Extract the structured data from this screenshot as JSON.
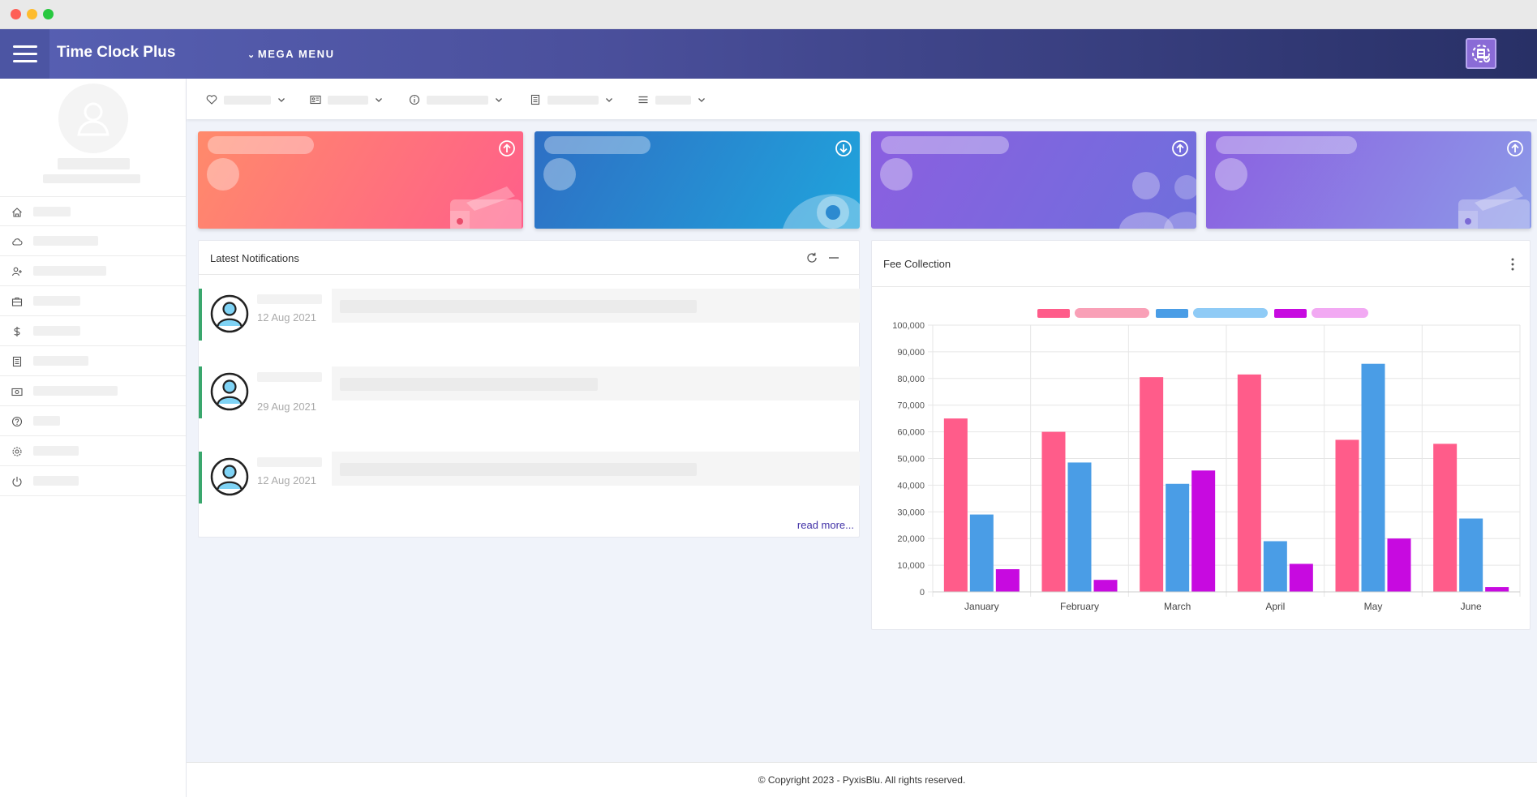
{
  "header": {
    "title": "Time Clock Plus",
    "mega_menu_label": "MEGA MENU",
    "menu_icon": "hamburger-icon",
    "profile_icon": "app-switch-icon"
  },
  "sidebar": {
    "profile_icon": "user-avatar-icon",
    "items": [
      {
        "icon": "home-icon"
      },
      {
        "icon": "cloud-icon"
      },
      {
        "icon": "user-add-icon"
      },
      {
        "icon": "briefcase-icon"
      },
      {
        "icon": "dollar-icon"
      },
      {
        "icon": "document-icon"
      },
      {
        "icon": "camera-icon"
      },
      {
        "icon": "help-icon"
      },
      {
        "icon": "settings-icon"
      },
      {
        "icon": "power-icon"
      }
    ]
  },
  "toolbar": {
    "items": [
      {
        "icon": "heart-icon"
      },
      {
        "icon": "id-card-icon"
      },
      {
        "icon": "info-icon"
      },
      {
        "icon": "document-icon"
      },
      {
        "icon": "list-icon"
      }
    ]
  },
  "stat_cards": [
    {
      "color_start": "#ff8a6b",
      "color_end": "#ff5f8a",
      "arrow_icon": "arrow-up-circle-icon",
      "decor_icon": "wallet-icon"
    },
    {
      "color_start": "#2e6fc4",
      "color_end": "#20a4dc",
      "arrow_icon": "arrow-down-circle-icon",
      "decor_icon": "eye-icon"
    },
    {
      "color_start": "#8b5fe0",
      "color_end": "#6f6fdc",
      "arrow_icon": "arrow-up-circle-icon",
      "decor_icon": "users-icon"
    },
    {
      "color_start": "#8b5fe0",
      "color_end": "#8c9ae8",
      "arrow_icon": "arrow-up-circle-icon",
      "decor_icon": "wallet-icon"
    }
  ],
  "notifications": {
    "title": "Latest Notifications",
    "refresh_icon": "refresh-icon",
    "minimize_icon": "minus-icon",
    "items": [
      {
        "date": "12 Aug 2021"
      },
      {
        "date": "29 Aug 2021"
      },
      {
        "date": "12 Aug 2021"
      }
    ],
    "read_more": "read more..."
  },
  "fee_collection": {
    "title": "Fee Collection",
    "menu_icon": "more-vertical-icon"
  },
  "chart_data": {
    "type": "bar",
    "title": "Fee Collection",
    "categories": [
      "January",
      "February",
      "March",
      "April",
      "May",
      "June"
    ],
    "series": [
      {
        "color": "#ff5c8a",
        "values": [
          65000,
          60000,
          80500,
          81500,
          57000,
          55500
        ]
      },
      {
        "color": "#4a9de6",
        "values": [
          29000,
          48500,
          40500,
          19000,
          85500,
          27500
        ]
      },
      {
        "color": "#c70ae0",
        "values": [
          8500,
          4500,
          45500,
          10500,
          20000,
          1800
        ]
      }
    ],
    "ylim": [
      0,
      100000
    ],
    "yticks": [
      "0",
      "10,000",
      "20,000",
      "30,000",
      "40,000",
      "50,000",
      "60,000",
      "70,000",
      "80,000",
      "90,000",
      "100,000"
    ],
    "grid": true,
    "legend": "top"
  },
  "footer": {
    "copyright": "© Copyright 2023 - PyxisBlu. All rights reserved."
  }
}
